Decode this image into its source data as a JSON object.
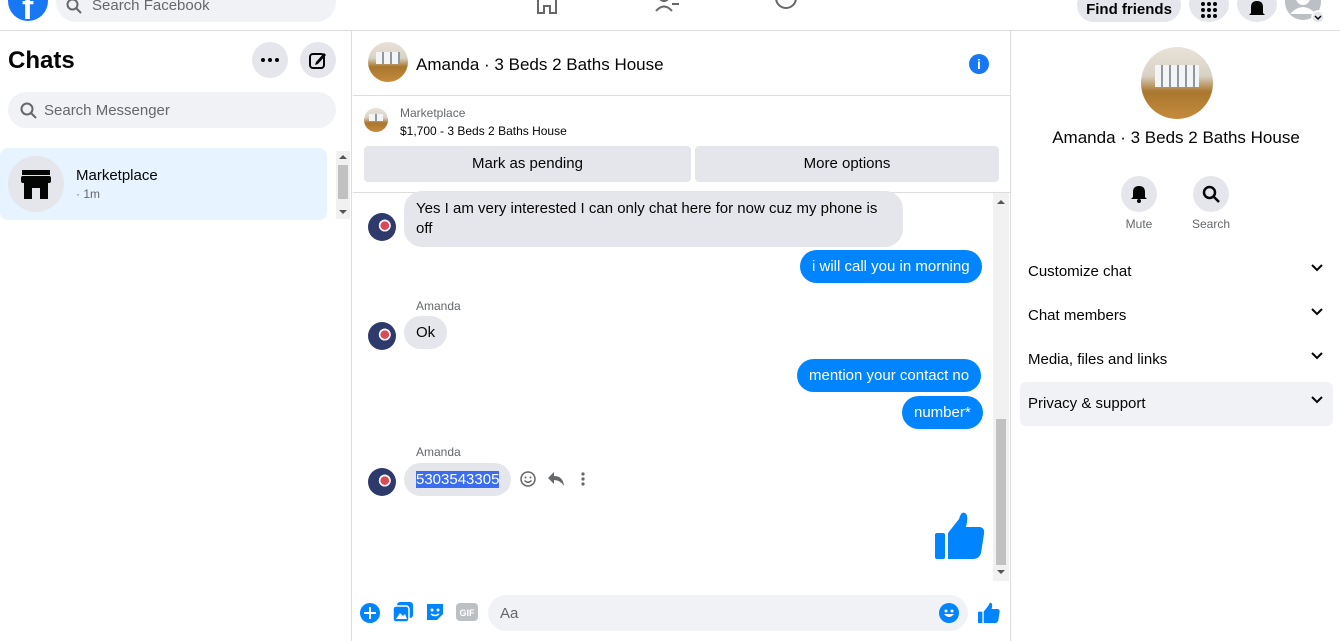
{
  "topbar": {
    "search_placeholder": "Search Facebook",
    "find_friends": "Find friends"
  },
  "sidebar": {
    "title": "Chats",
    "search_placeholder": "Search Messenger",
    "chats": [
      {
        "name": "Marketplace",
        "time": "· 1m"
      }
    ]
  },
  "conversation": {
    "title": "Amanda · 3 Beds 2 Baths House",
    "listing_label": "Marketplace",
    "listing_price": "$1,700 - 3 Beds 2 Baths House",
    "mark_pending": "Mark as pending",
    "more_options": "More options",
    "messages": {
      "m1": "Yes I am very interested I can only chat here for now cuz my phone is off",
      "m2": "i will call you in morning",
      "sender": "Amanda",
      "m3": "Ok",
      "m4": "mention your contact no",
      "m5": "number*",
      "m6": "5303543305"
    },
    "composer_placeholder": "Aa"
  },
  "details": {
    "name": "Amanda · 3 Beds 2 Baths House",
    "mute": "Mute",
    "search": "Search",
    "rows": [
      "Customize chat",
      "Chat members",
      "Media, files and links",
      "Privacy & support"
    ]
  },
  "colors": {
    "accent": "#0084ff",
    "brand": "#1877f2"
  }
}
